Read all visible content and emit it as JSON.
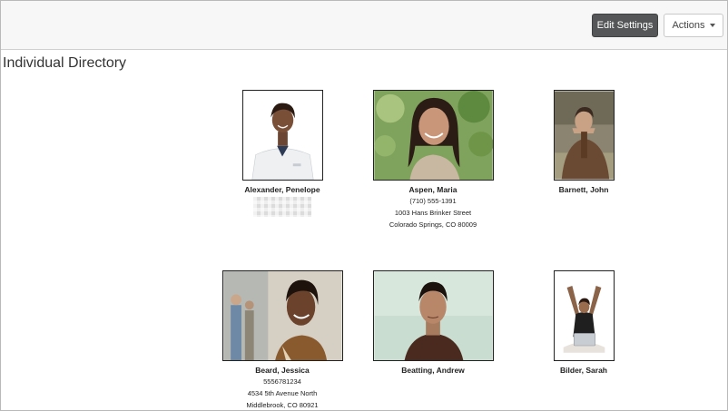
{
  "toolbar": {
    "edit_settings_label": "Edit Settings",
    "actions_label": "Actions"
  },
  "page": {
    "title": "Individual Directory"
  },
  "people": [
    {
      "name": "Alexander, Penelope",
      "phone": "",
      "street": "",
      "city": ""
    },
    {
      "name": "Aspen, Maria",
      "phone": "(710) 555-1391",
      "street": "1003 Hans Brinker Street",
      "city": "Colorado Springs, CO 80009"
    },
    {
      "name": "Barnett, John",
      "phone": "",
      "street": "",
      "city": ""
    },
    {
      "name": "Beard, Jessica",
      "phone": "5556781234",
      "street": "4534 5th Avenue North",
      "city": "Middlebrook, CO 80921"
    },
    {
      "name": "Beatting, Andrew",
      "phone": "",
      "street": "",
      "city": ""
    },
    {
      "name": "Bilder, Sarah",
      "phone": "",
      "street": "",
      "city": ""
    }
  ],
  "colors": {
    "primary_button": "#545657",
    "toolbar_bg": "#f7f7f7"
  },
  "icons": {
    "actions_dropdown": "caret-down-icon"
  }
}
